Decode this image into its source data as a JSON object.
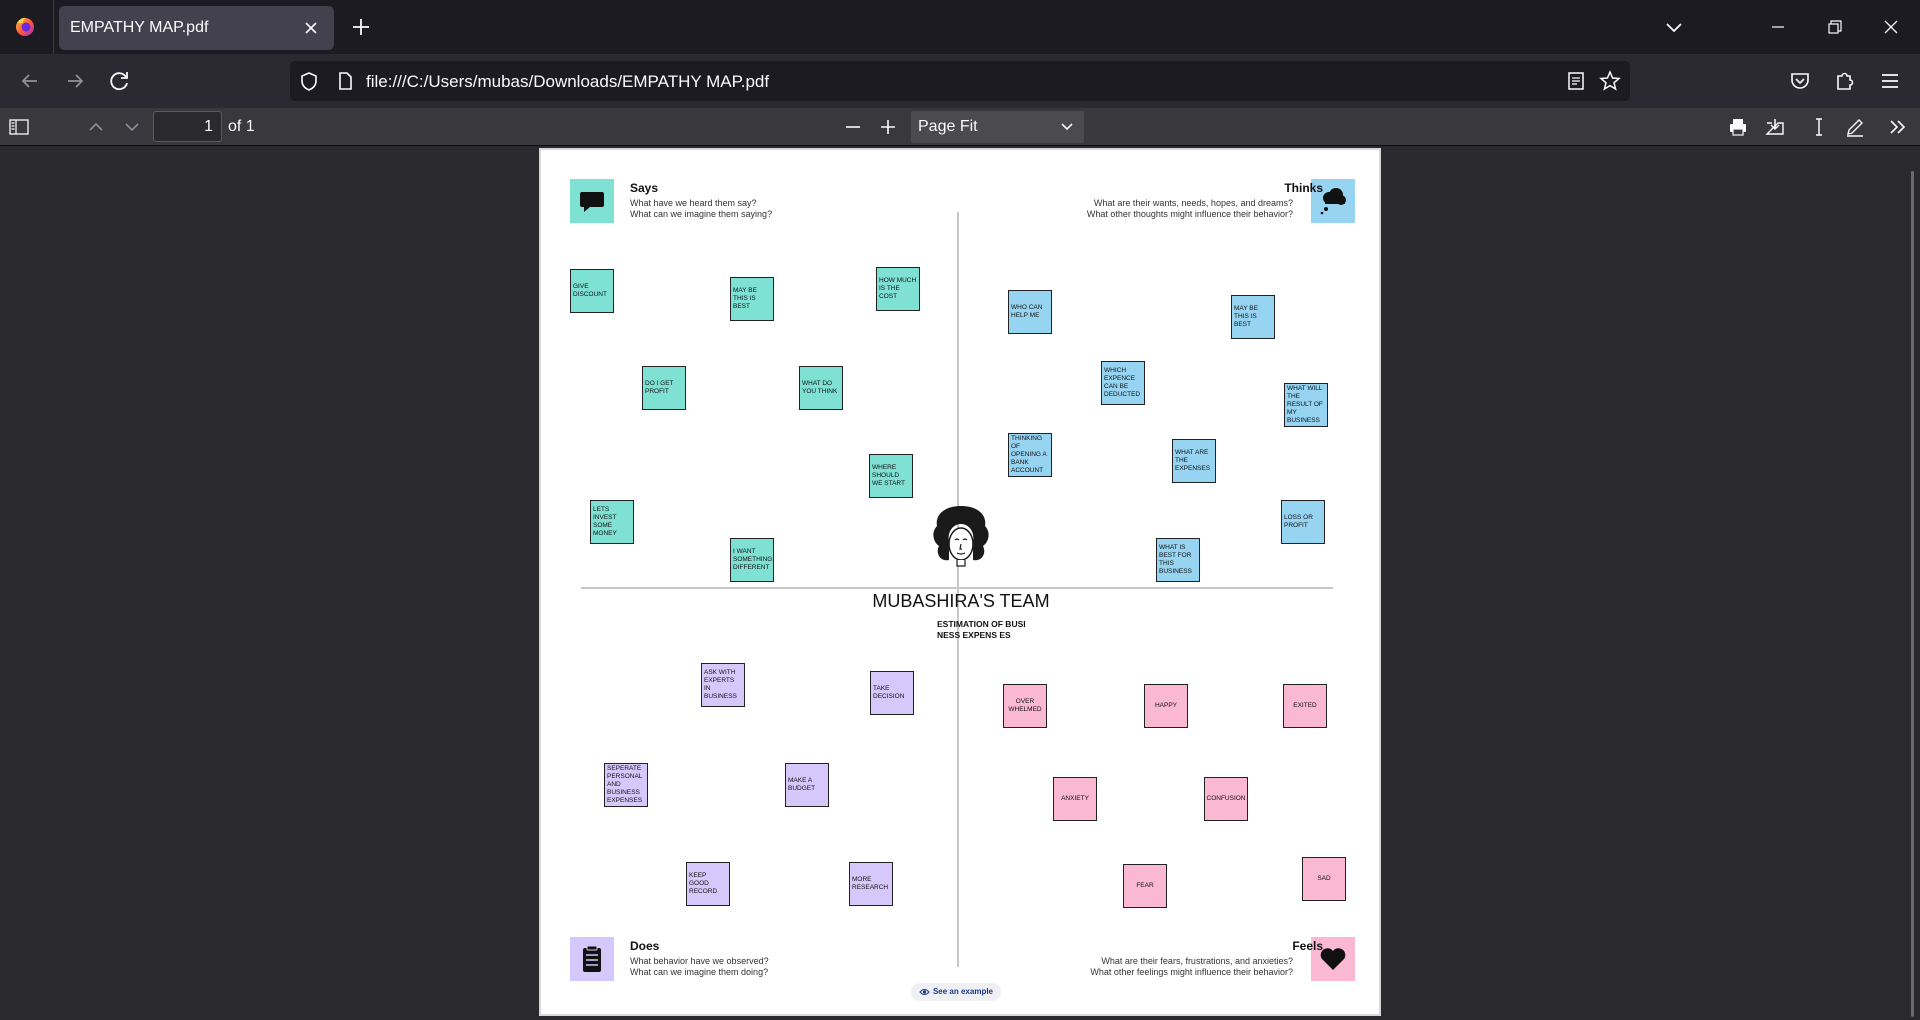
{
  "browser": {
    "tab_title": "EMPATHY MAP.pdf",
    "url": "file:///C:/Users/mubas/Downloads/EMPATHY MAP.pdf"
  },
  "pdf_toolbar": {
    "page_number": "1",
    "page_of": "of 1",
    "zoom": "Page Fit"
  },
  "map": {
    "says": {
      "title": "Says",
      "sub1": "What have we heard them say?",
      "sub2": "What can we imagine them saying?",
      "notes": [
        "GIVE DISCOUNT",
        "MAY BE THIS IS BEST",
        "HOW MUCH IS THE COST",
        "DO I GET PROFIT",
        "WHAT DO YOU THINK",
        "WHERE SHOULD WE START",
        "LETS INVEST SOME MONEY",
        "I WANT SOMETHING DIFFERENT"
      ]
    },
    "thinks": {
      "title": "Thinks",
      "sub1": "What are their wants, needs, hopes, and dreams?",
      "sub2": "What other thoughts might influence their behavior?",
      "notes": [
        "WHO CAN HELP ME",
        "MAY BE THIS IS BEST",
        "WHICH EXPENCE CAN BE DEDUCTED",
        "WHAT WILL THE RESULT OF MY BUSINESS",
        "THINKING OF OPENING A BANK ACCOUNT",
        "WHAT ARE THE EXPENSES",
        "LOSS OR PROFIT",
        "WHAT IS BEST FOR THIS BUSINESS"
      ]
    },
    "does": {
      "title": "Does",
      "sub1": "What behavior have we observed?",
      "sub2": "What can we imagine them doing?",
      "notes": [
        "ASK WITH EXPERTS IN BUSINESS",
        "TAKE DECISION",
        "SEPERATE PERSONAL AND BUSINESS EXPENSES",
        "MAKE A BUDGET",
        "KEEP GOOD RECORD",
        "MORE RESEARCH"
      ]
    },
    "feels": {
      "title": "Feels",
      "sub1": "What are their fears, frustrations, and anxieties?",
      "sub2": "What other feelings might influence their behavior?",
      "notes": [
        "OVER WHELMED",
        "HAPPY",
        "EXITED",
        "ANXIETY",
        "CONFUSION",
        "FEAR",
        "SAD"
      ]
    },
    "team": "MUBASHIRA'S TEAM",
    "subtitle": "ESTIMATION OF BUSINESS EXPENS ES",
    "example_link": "See an example"
  },
  "colors": {
    "says": "#7fe1d4",
    "thinks": "#96d4f2",
    "does": "#d7c8fb",
    "feels": "#fbb8d3"
  }
}
